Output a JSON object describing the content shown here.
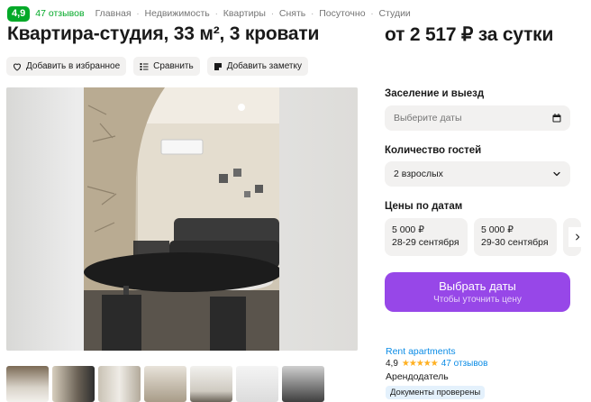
{
  "header": {
    "rating": "4,9",
    "reviews": "47 отзывов",
    "breadcrumbs": [
      "Главная",
      "Недвижимость",
      "Квартиры",
      "Снять",
      "Посуточно",
      "Студии"
    ]
  },
  "listing": {
    "title": "Квартира-студия, 33 м², 3 кровати",
    "price": "от 2 517 ₽ за сутки"
  },
  "actions": {
    "favorite": "Добавить в избранное",
    "compare": "Сравнить",
    "note": "Добавить заметку"
  },
  "booking": {
    "dates_label": "Заселение и выезд",
    "dates_placeholder": "Выберите даты",
    "guests_label": "Количество гостей",
    "guests_value": "2 взрослых",
    "prices_label": "Цены по датам",
    "date_prices": [
      {
        "price": "5 000 ₽",
        "dates": "28-29 сентября"
      },
      {
        "price": "5 000 ₽",
        "dates": "29-30 сентября"
      }
    ],
    "cta_main": "Выбрать даты",
    "cta_sub": "Чтобы уточнить цену"
  },
  "seller": {
    "name": "Rent apartments",
    "rating": "4,9",
    "stars": 5,
    "reviews": "47 отзывов",
    "role": "Арендодатель",
    "badge": "Документы проверены"
  },
  "colors": {
    "rating_green": "#03a928",
    "cta_purple": "#9747e8",
    "link_blue": "#0b8ce6",
    "star": "#ffb021"
  }
}
